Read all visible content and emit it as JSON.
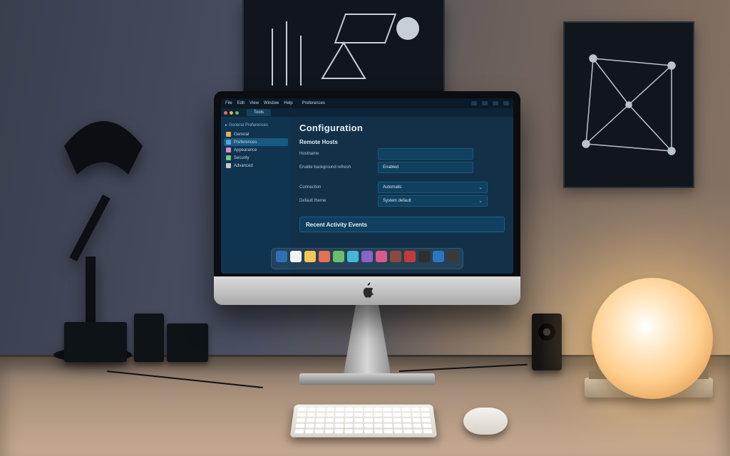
{
  "menubar": {
    "items": [
      "File",
      "Edit",
      "View",
      "Window",
      "Help"
    ],
    "right_label": "Preferences"
  },
  "window": {
    "tab_label": "Tools"
  },
  "sidebar": {
    "header": "General Preferences",
    "items": [
      {
        "icon": "#e0b24f",
        "label": "General"
      },
      {
        "icon": "#5aa0d8",
        "label": "Preferences"
      },
      {
        "icon": "#d78bd0",
        "label": "Appearance"
      },
      {
        "icon": "#7fc27a",
        "label": "Security"
      },
      {
        "icon": "#c9c9c9",
        "label": "Advanced"
      }
    ],
    "active_index": 1
  },
  "page": {
    "title": "Configuration",
    "section1": {
      "title": "Remote Hosts",
      "rows": [
        {
          "label": "Hostname",
          "value": ""
        },
        {
          "label": "Enable background refresh",
          "value": "Enabled"
        }
      ]
    },
    "section2": {
      "rows": [
        {
          "label": "Connection",
          "value": "Automatic",
          "type": "select"
        },
        {
          "label": "Default theme",
          "value": "System default",
          "type": "select"
        }
      ]
    },
    "banner": "Recent Activity Events"
  },
  "dock": [
    "#2f6fb3",
    "#f2f2f2",
    "#f4c653",
    "#e86f52",
    "#69c06b",
    "#47b7d8",
    "#8a62c9",
    "#d85a89",
    "#8a4b3e",
    "#c43a3a",
    "#2e2e2e",
    "#2b75c4",
    "#3a3a3a"
  ]
}
